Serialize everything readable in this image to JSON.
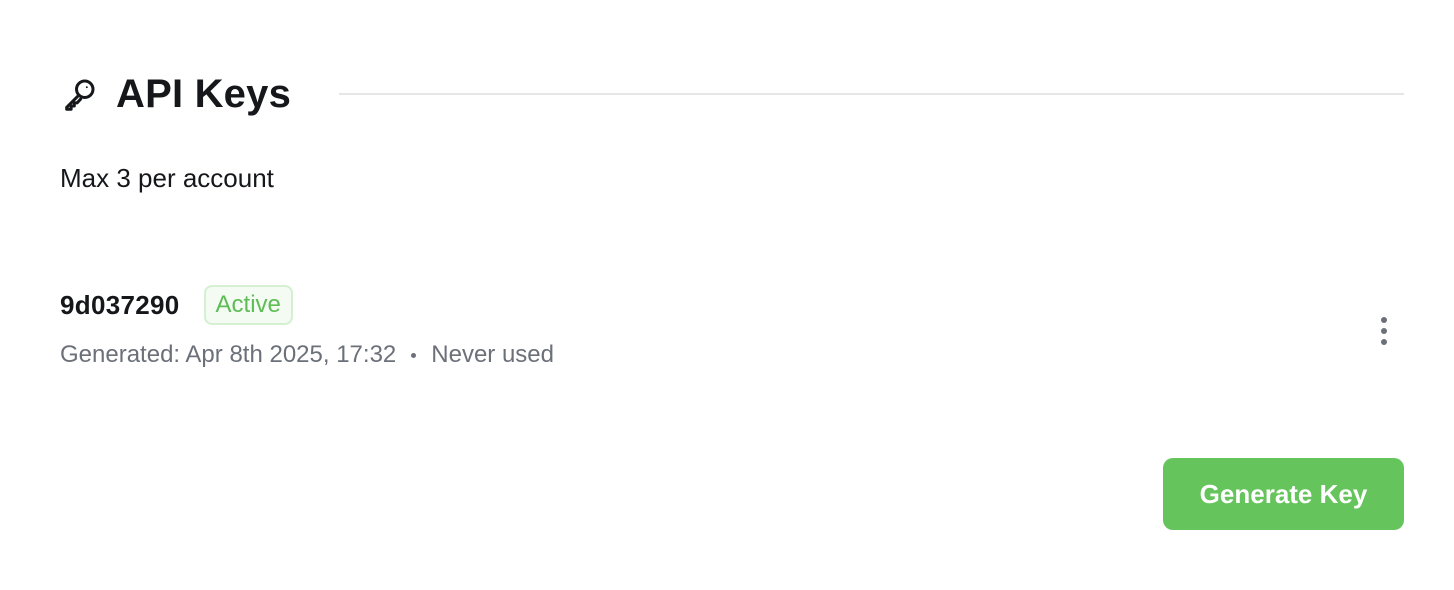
{
  "header": {
    "title": "API Keys",
    "icon": "key-icon"
  },
  "subtitle": "Max 3 per account",
  "keys": [
    {
      "id": "9d037290",
      "status": "Active",
      "status_color": "#5ebd55",
      "generated": "Generated: Apr 8th 2025, 17:32",
      "last_used": "Never used",
      "menu_icon": "more-vertical-icon"
    }
  ],
  "actions": {
    "generate_label": "Generate Key",
    "generate_color": "#66c45c"
  }
}
